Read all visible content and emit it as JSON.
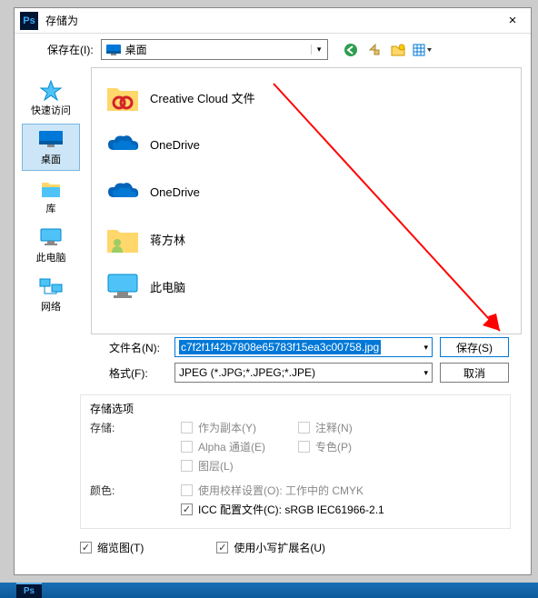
{
  "titlebar": {
    "app_icon": "Ps",
    "title": "存储为",
    "close": "×"
  },
  "toolbar": {
    "save_in_label": "保存在(I):",
    "location": "桌面",
    "nav": {
      "back": "←",
      "up": "↥",
      "new_folder": "📂",
      "views": "▦▾"
    }
  },
  "places": [
    {
      "label": "快速访问",
      "icon": "star"
    },
    {
      "label": "桌面",
      "icon": "desktop",
      "selected": true
    },
    {
      "label": "库",
      "icon": "libraries"
    },
    {
      "label": "此电脑",
      "icon": "thispc"
    },
    {
      "label": "网络",
      "icon": "network"
    }
  ],
  "files": [
    {
      "label": "Creative Cloud 文件",
      "icon": "ccfolder"
    },
    {
      "label": "OneDrive",
      "icon": "onedrive"
    },
    {
      "label": "OneDrive",
      "icon": "onedrive"
    },
    {
      "label": "蒋方林",
      "icon": "userfolder"
    },
    {
      "label": "此电脑",
      "icon": "thispc-large"
    }
  ],
  "form": {
    "filename_label": "文件名(N):",
    "filename_value": "c7f2f1f42b7808e65783f15ea3c00758.jpg",
    "format_label": "格式(F):",
    "format_value": "JPEG (*.JPG;*.JPEG;*.JPE)",
    "save_btn": "保存(S)",
    "cancel_btn": "取消"
  },
  "options": {
    "section_label": "存储选项",
    "store_label": "存储:",
    "as_copy": "作为副本(Y)",
    "annotations": "注释(N)",
    "alpha": "Alpha 通道(E)",
    "spot": "专色(P)",
    "layers": "图层(L)",
    "color_label": "颜色:",
    "proof": "使用校样设置(O): 工作中的 CMYK",
    "icc": "ICC 配置文件(C): sRGB IEC61966-2.1"
  },
  "bottom": {
    "thumbnail": "缩览图(T)",
    "lowercase_ext": "使用小写扩展名(U)"
  },
  "taskbar": {
    "ps": "Ps"
  }
}
